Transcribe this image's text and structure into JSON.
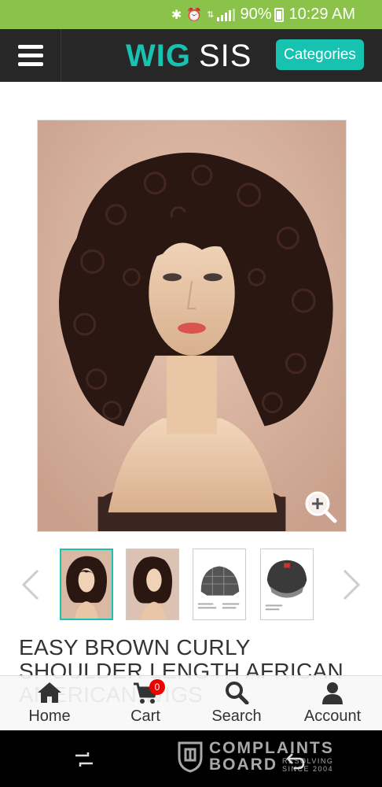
{
  "status_bar": {
    "battery": "90%",
    "time": "10:29 AM",
    "icons": [
      "bluetooth-icon",
      "alarm-icon",
      "data-icon",
      "signal-icon",
      "battery-icon"
    ]
  },
  "header": {
    "logo_part1": "WIG",
    "logo_part2": "SIS",
    "categories_label": "Categories",
    "brand_color": "#17c2b0"
  },
  "gallery": {
    "thumbnail_count": 4,
    "selected_index": 0
  },
  "product": {
    "title": "EASY BROWN CURLY SHOULDER LENGTH AFRICAN AMERICAN WIGS"
  },
  "bottom_nav": {
    "items": [
      {
        "label": "Home",
        "icon": "home-icon"
      },
      {
        "label": "Cart",
        "icon": "cart-icon",
        "badge": "0"
      },
      {
        "label": "Search",
        "icon": "search-icon"
      },
      {
        "label": "Account",
        "icon": "account-icon"
      }
    ]
  },
  "watermark": {
    "line1": "COMPLAINTS",
    "line2": "BOARD",
    "tag1": "RESOLVING",
    "tag2": "SINCE 2004"
  }
}
